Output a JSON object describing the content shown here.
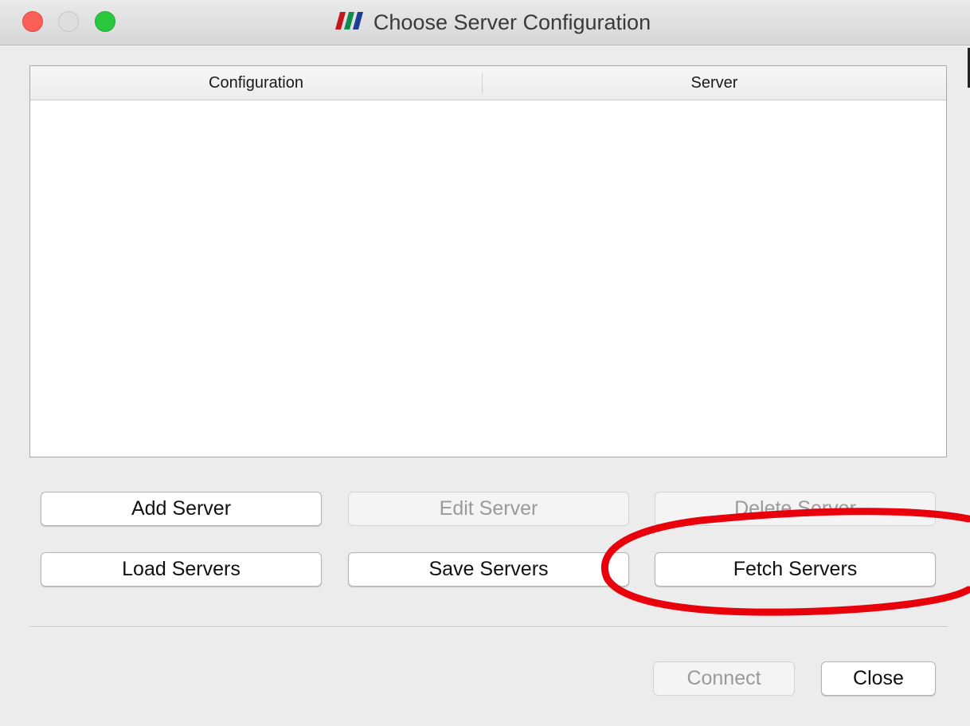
{
  "window": {
    "title": "Choose Server Configuration",
    "app_icon": "paraview-logo-icon"
  },
  "table": {
    "columns": [
      "Configuration",
      "Server"
    ],
    "rows": []
  },
  "buttons": {
    "add_server": "Add Server",
    "edit_server": "Edit Server",
    "delete_server": "Delete Server",
    "load_servers": "Load Servers",
    "save_servers": "Save Servers",
    "fetch_servers": "Fetch Servers",
    "connect": "Connect",
    "close": "Close"
  },
  "colors": {
    "annotation_ring": "#e8000b",
    "traffic_close": "#fc5f57",
    "traffic_zoom": "#2ac83f"
  }
}
